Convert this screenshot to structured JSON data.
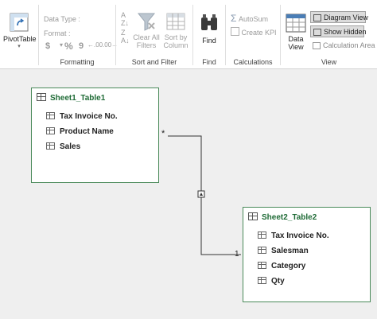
{
  "ribbon": {
    "pivot_label": "PivotTable",
    "data_type_label": "Data Type :",
    "format_label": "Format :",
    "currency_symbol": "$",
    "percent_symbol": "%",
    "comma_symbol": "9",
    "groups": {
      "formatting": "Formatting",
      "sort_filter": "Sort and Filter",
      "find": "Find",
      "calculations": "Calculations",
      "view": "View"
    },
    "clear_filters_line1": "Clear All",
    "clear_filters_line2": "Filters",
    "sort_by_line1": "Sort by",
    "sort_by_line2": "Column",
    "find_label": "Find",
    "autosum_label": "AutoSum",
    "create_kpi_label": "Create KPI",
    "data_view_line1": "Data",
    "data_view_line2": "View",
    "diagram_view_label": "Diagram View",
    "show_hidden_label": "Show Hidden",
    "calc_area_label": "Calculation Area"
  },
  "diagram": {
    "table1": {
      "title": "Sheet1_Table1",
      "columns": [
        "Tax Invoice No.",
        "Product Name",
        "Sales"
      ]
    },
    "table2": {
      "title": "Sheet2_Table2",
      "columns": [
        "Tax Invoice No.",
        "Salesman",
        "Category",
        "Qty"
      ]
    },
    "relationship": {
      "many_marker": "*",
      "one_marker": "1"
    }
  }
}
